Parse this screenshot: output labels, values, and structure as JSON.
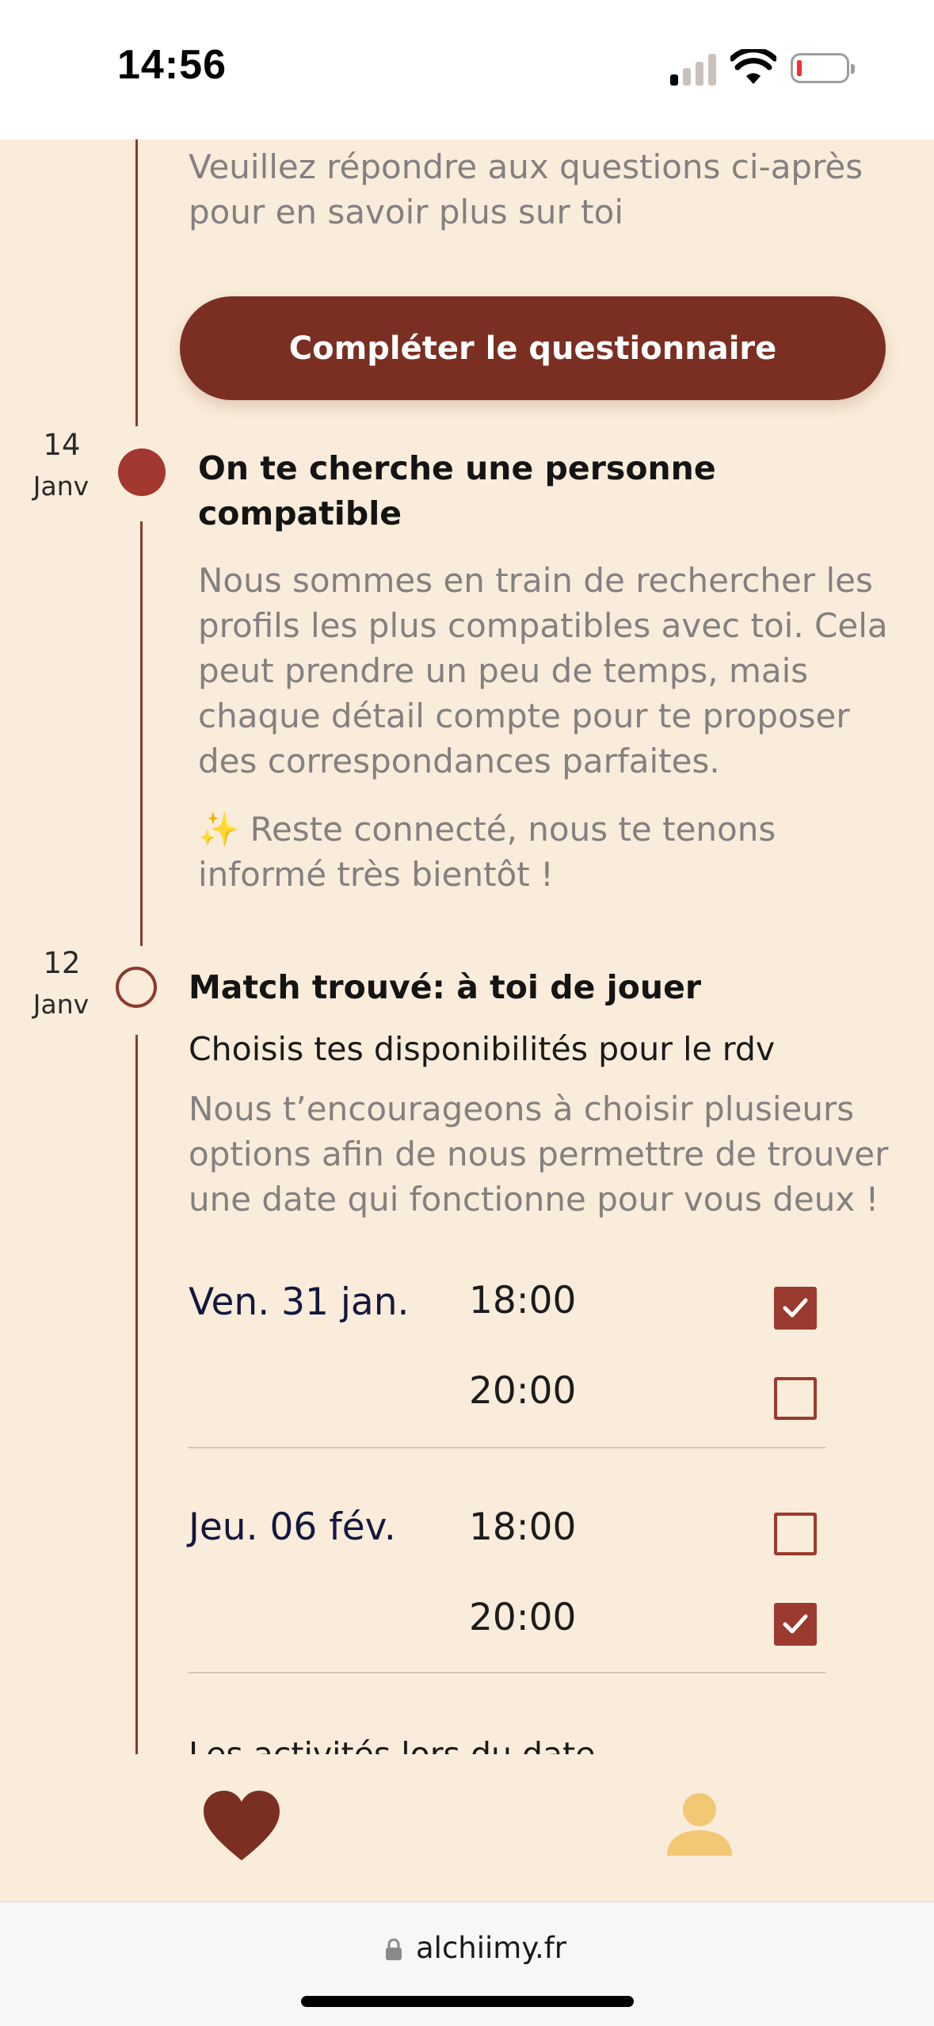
{
  "status_bar": {
    "time": "14:56"
  },
  "timeline": {
    "questionnaire": {
      "description": "Veuillez répondre aux questions ci-après pour en savoir plus sur toi",
      "button_label": "Compléter le questionnaire"
    },
    "search_step": {
      "date_day": "14",
      "date_month": "Janv",
      "title": "On te cherche une personne compatible",
      "description": "Nous sommes en train de rechercher les profils les plus compatibles avec toi. Cela peut prendre un peu de temps, mais chaque détail compte pour te proposer des correspondances parfaites.",
      "note_emoji": "✨",
      "note": "Reste connecté, nous te tenons informé très bientôt !"
    },
    "match_step": {
      "date_day": "12",
      "date_month": "Janv",
      "title": "Match trouvé: à toi de jouer",
      "subtitle": "Choisis tes disponibilités pour le rdv",
      "description": "Nous t’encourageons à choisir plusieurs options afin de nous permettre de trouver une date qui fonctionne pour vous deux !",
      "availability": [
        {
          "day": "Ven. 31 jan.",
          "slots": [
            {
              "time": "18:00",
              "checked": true
            },
            {
              "time": "20:00",
              "checked": false
            }
          ]
        },
        {
          "day": "Jeu. 06 fév.",
          "slots": [
            {
              "time": "18:00",
              "checked": false
            },
            {
              "time": "20:00",
              "checked": true
            }
          ]
        }
      ],
      "activities_heading": "Les activités lors du date"
    }
  },
  "url_bar": {
    "url": "alchiimy.fr"
  },
  "colors": {
    "background": "#f9ecda",
    "accent": "#7a2f22",
    "timeline": "#8b3a30",
    "person_icon": "#f2c874"
  }
}
